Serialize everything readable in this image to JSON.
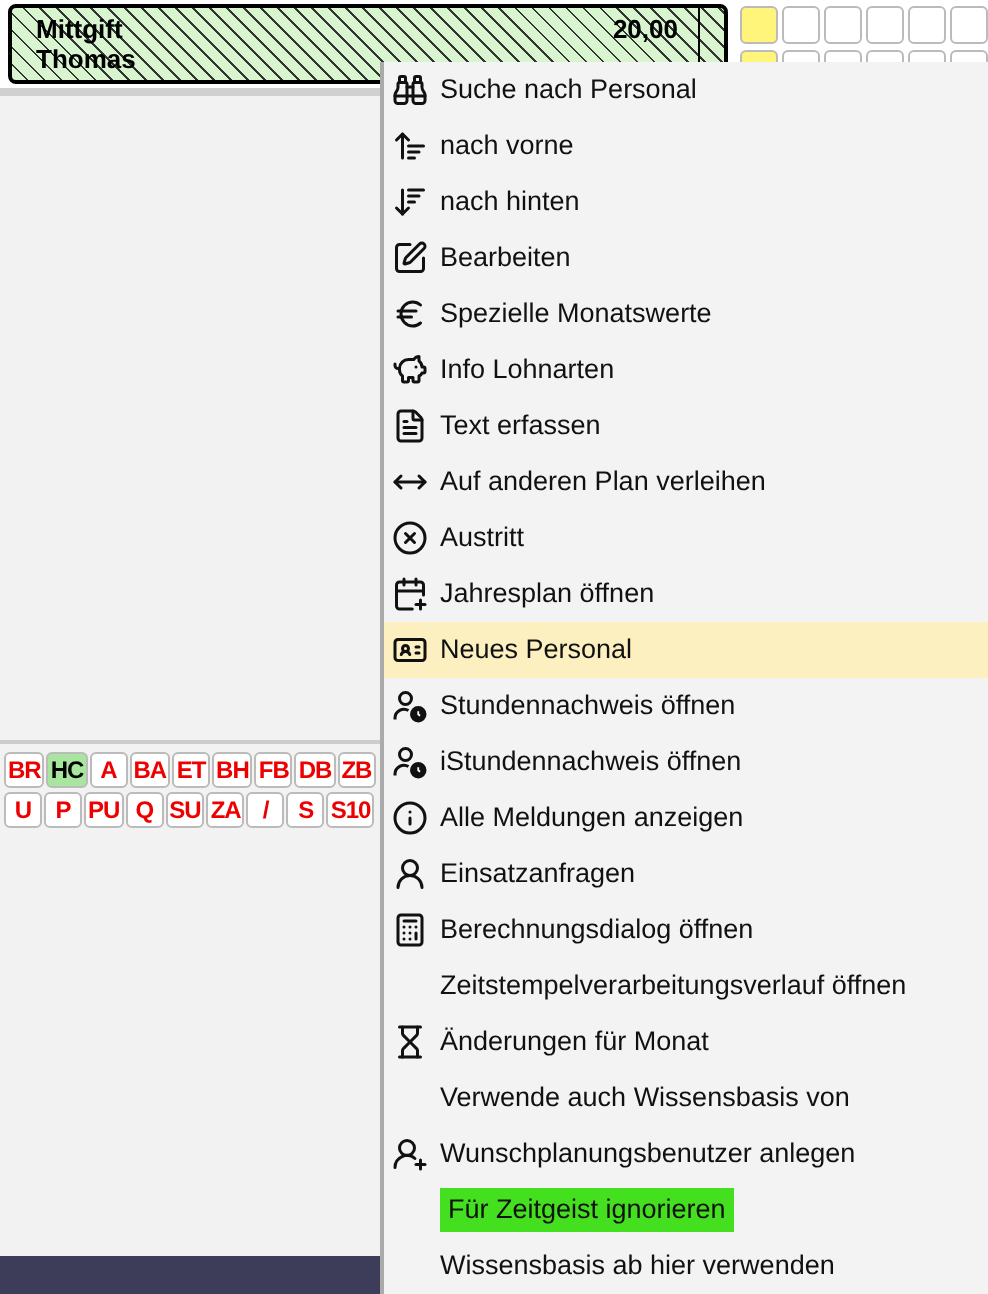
{
  "shift_card": {
    "name": "Mittgift",
    "first_name": "Thomas",
    "value": "20,00"
  },
  "day_grid": {
    "rows": [
      [
        {
          "selected": true
        },
        {
          "selected": false
        },
        {
          "selected": false
        },
        {
          "selected": false
        },
        {
          "selected": false
        },
        {
          "selected": false
        }
      ],
      [
        {
          "selected": true
        },
        {
          "selected": false
        },
        {
          "selected": false
        },
        {
          "selected": false
        },
        {
          "selected": false
        },
        {
          "selected": false
        }
      ]
    ]
  },
  "codes": [
    [
      {
        "label": "BR",
        "selected": false
      },
      {
        "label": "HC",
        "selected": true
      },
      {
        "label": "A",
        "selected": false
      },
      {
        "label": "BA",
        "selected": false
      },
      {
        "label": "ET",
        "selected": false
      },
      {
        "label": "BH",
        "selected": false
      },
      {
        "label": "FB",
        "selected": false
      },
      {
        "label": "DB",
        "selected": false
      },
      {
        "label": "ZB",
        "selected": false
      }
    ],
    [
      {
        "label": "U",
        "selected": false
      },
      {
        "label": "P",
        "selected": false
      },
      {
        "label": "PU",
        "selected": false
      },
      {
        "label": "Q",
        "selected": false
      },
      {
        "label": "SU",
        "selected": false
      },
      {
        "label": "ZA",
        "selected": false
      },
      {
        "label": "/",
        "selected": false
      },
      {
        "label": "S",
        "selected": false
      },
      {
        "label": "S10",
        "selected": false
      }
    ]
  ],
  "context_menu": [
    {
      "label": "Suche nach Personal",
      "selected": false,
      "highlighted": false
    },
    {
      "label": "nach vorne",
      "selected": false,
      "highlighted": false
    },
    {
      "label": "nach hinten",
      "selected": false,
      "highlighted": false
    },
    {
      "label": "Bearbeiten",
      "selected": false,
      "highlighted": false
    },
    {
      "label": "Spezielle Monatswerte",
      "selected": false,
      "highlighted": false
    },
    {
      "label": "Info Lohnarten",
      "selected": false,
      "highlighted": false
    },
    {
      "label": "Text erfassen",
      "selected": false,
      "highlighted": false
    },
    {
      "label": "Auf anderen Plan verleihen",
      "selected": false,
      "highlighted": false
    },
    {
      "label": "Austritt",
      "selected": false,
      "highlighted": false
    },
    {
      "label": "Jahresplan öffnen",
      "selected": false,
      "highlighted": false
    },
    {
      "label": "Neues Personal",
      "selected": true,
      "highlighted": false
    },
    {
      "label": "Stundennachweis öffnen",
      "selected": false,
      "highlighted": false
    },
    {
      "label": "iStundennachweis öffnen",
      "selected": false,
      "highlighted": false
    },
    {
      "label": "Alle Meldungen anzeigen",
      "selected": false,
      "highlighted": false
    },
    {
      "label": "Einsatzanfragen",
      "selected": false,
      "highlighted": false
    },
    {
      "label": "Berechnungsdialog öffnen",
      "selected": false,
      "highlighted": false
    },
    {
      "label": "Zeitstempelverarbeitungsverlauf öffnen",
      "selected": false,
      "highlighted": false
    },
    {
      "label": "Änderungen für Monat",
      "selected": false,
      "highlighted": false
    },
    {
      "label": "Verwende auch Wissensbasis von",
      "selected": false,
      "highlighted": false
    },
    {
      "label": "Wunschplanungsbenutzer anlegen",
      "selected": false,
      "highlighted": false
    },
    {
      "label": "Für Zeitgeist ignorieren",
      "selected": false,
      "highlighted": true
    },
    {
      "label": "Wissensbasis ab hier verwenden",
      "selected": false,
      "highlighted": false
    }
  ]
}
